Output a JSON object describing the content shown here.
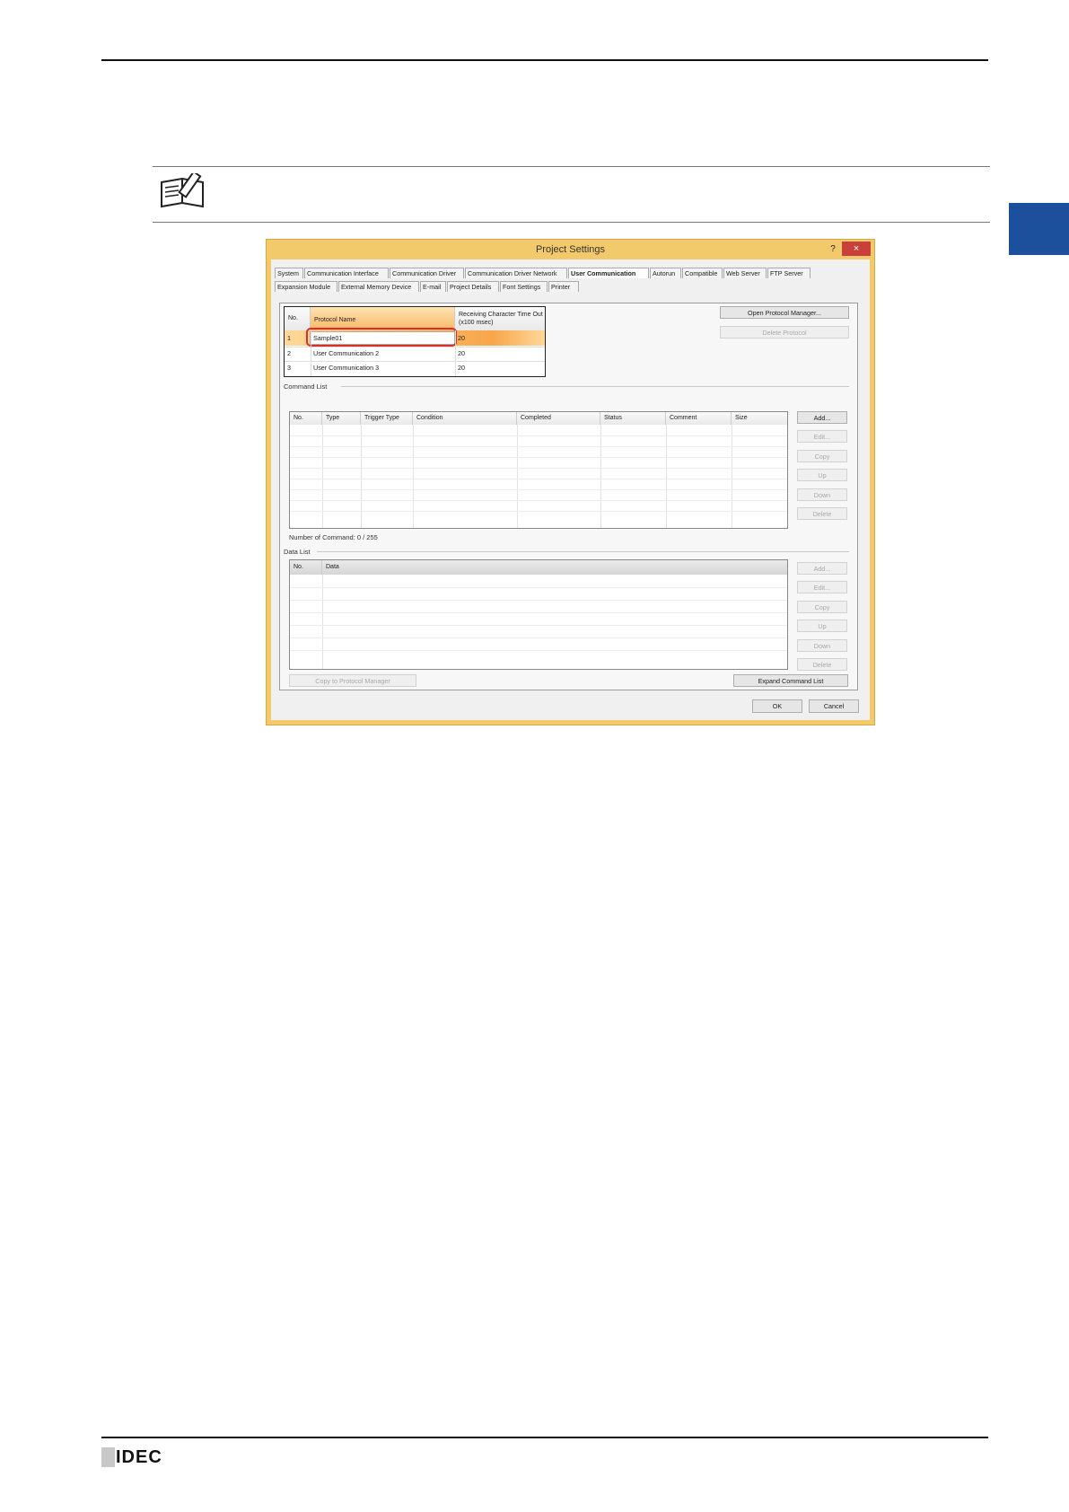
{
  "dialog": {
    "title": "Project Settings",
    "help_label": "?",
    "close_label": "×",
    "tabs_row1": [
      "System",
      "Communication Interface",
      "Communication Driver",
      "Communication Driver Network",
      "User Communication",
      "Autorun",
      "Compatible",
      "Web Server",
      "FTP Server"
    ],
    "tabs_row2": [
      "Expansion Module",
      "External Memory Device",
      "E-mail",
      "Project Details",
      "Font Settings",
      "Printer"
    ],
    "active_tab": "User Communication",
    "protocol_table": {
      "columns": [
        "No.",
        "Protocol Name",
        "Receiving Character Time Out (x100 msec)"
      ],
      "rows": [
        {
          "no": "1",
          "name": "Sample01",
          "timeout": "20"
        },
        {
          "no": "2",
          "name": "User Communication 2",
          "timeout": "20"
        },
        {
          "no": "3",
          "name": "User Communication 3",
          "timeout": "20"
        }
      ]
    },
    "open_protocol_manager_label": "Open Protocol Manager...",
    "delete_protocol_label": "Delete Protocol",
    "command_list": {
      "label": "Command List",
      "columns": [
        "No.",
        "Type",
        "Trigger Type",
        "Condition",
        "Completed",
        "Status",
        "Comment",
        "Size"
      ],
      "buttons": [
        "Add...",
        "Edit...",
        "Copy",
        "Up",
        "Down",
        "Delete"
      ],
      "count_text": "Number of Command: 0 / 255"
    },
    "data_list": {
      "label": "Data List",
      "columns": [
        "No.",
        "Data"
      ],
      "buttons": [
        "Add...",
        "Edit...",
        "Copy",
        "Up",
        "Down",
        "Delete"
      ]
    },
    "copy_to_protocol_manager_label": "Copy to Protocol Manager",
    "expand_command_list_label": "Expand Command List",
    "ok_label": "OK",
    "cancel_label": "Cancel"
  },
  "footer": {
    "logo_text": "IDEC"
  },
  "colors": {
    "accent_tab": "#1c4f9c",
    "dialog_frame": "#f3ca6b",
    "highlight_outline": "#d9302a"
  }
}
